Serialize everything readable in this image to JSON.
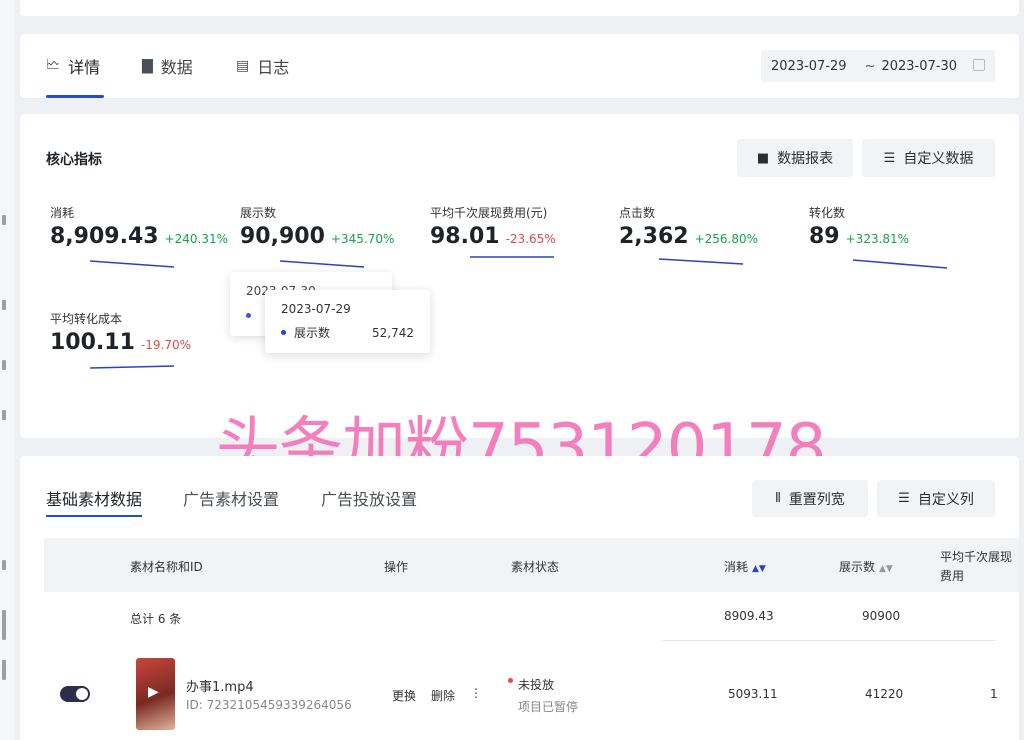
{
  "tabs": [
    {
      "label": "详情",
      "icon": "chart-line-icon"
    },
    {
      "label": "数据",
      "icon": "bar-chart-icon"
    },
    {
      "label": "日志",
      "icon": "clipboard-icon"
    }
  ],
  "date_range": {
    "start": "2023-07-29",
    "separator": "~",
    "end": "2023-07-30"
  },
  "core": {
    "title": "核心指标",
    "report_button": "数据报表",
    "custom_button": "自定义数据",
    "metrics": [
      {
        "label": "消耗",
        "value": "8,909.43",
        "change": "+240.31%",
        "trend": "up"
      },
      {
        "label": "展示数",
        "value": "90,900",
        "change": "+345.70%",
        "trend": "up"
      },
      {
        "label": "平均千次展现费用(元)",
        "value": "98.01",
        "change": "-23.65%",
        "trend": "down"
      },
      {
        "label": "点击数",
        "value": "2,362",
        "change": "+256.80%",
        "trend": "up"
      },
      {
        "label": "转化数",
        "value": "89",
        "change": "+323.81%",
        "trend": "up"
      },
      {
        "label": "平均转化成本",
        "value": "100.11",
        "change": "-19.70%",
        "trend": "down"
      }
    ],
    "tooltip_back": {
      "date": "2023-07-30"
    },
    "tooltip": {
      "date": "2023-07-29",
      "series": "展示数",
      "value": "52,742"
    }
  },
  "watermark": "头条加粉753120178",
  "table": {
    "tabs": [
      "基础素材数据",
      "广告素材设置",
      "广告投放设置"
    ],
    "reset_button": "重置列宽",
    "custom_columns_button": "自定义列",
    "columns": [
      "素材名称和ID",
      "操作",
      "素材状态",
      "消耗",
      "展示数",
      "平均千次展现费用"
    ],
    "total": {
      "label": "总计 6 条",
      "cost": "8909.43",
      "impressions": "90900"
    },
    "rows": [
      {
        "name": "办事1.mp4",
        "id": "ID: 7232105459339264056",
        "action_replace": "更换",
        "action_delete": "删除",
        "status": "未投放",
        "substatus": "项目已暂停",
        "cost": "5093.11",
        "impressions": "41220",
        "cpm": "1"
      }
    ]
  }
}
